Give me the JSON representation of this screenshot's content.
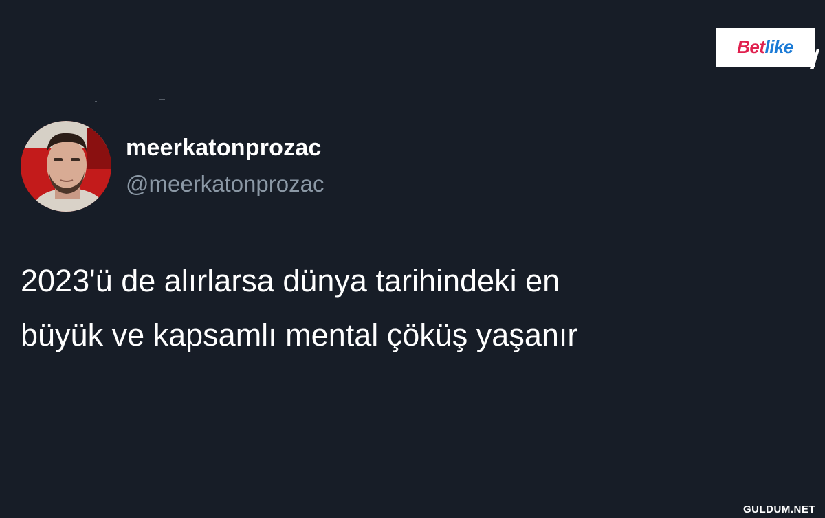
{
  "tweet": {
    "display_name": "meerkatonprozac",
    "handle": "@meerkatonprozac",
    "text_lines": [
      "2023'ü de alırlarsa dünya tarihindeki en",
      "büyük ve kapsamlı mental çöküş yaşanır"
    ]
  },
  "logo": {
    "part1": "Bet",
    "part2": "like"
  },
  "watermark": "GULDUM.NET",
  "colors": {
    "background": "#171d27",
    "text": "#ffffff",
    "handle": "#8b98a5",
    "logo_red": "#e0204e",
    "logo_blue": "#1c7bd6"
  }
}
